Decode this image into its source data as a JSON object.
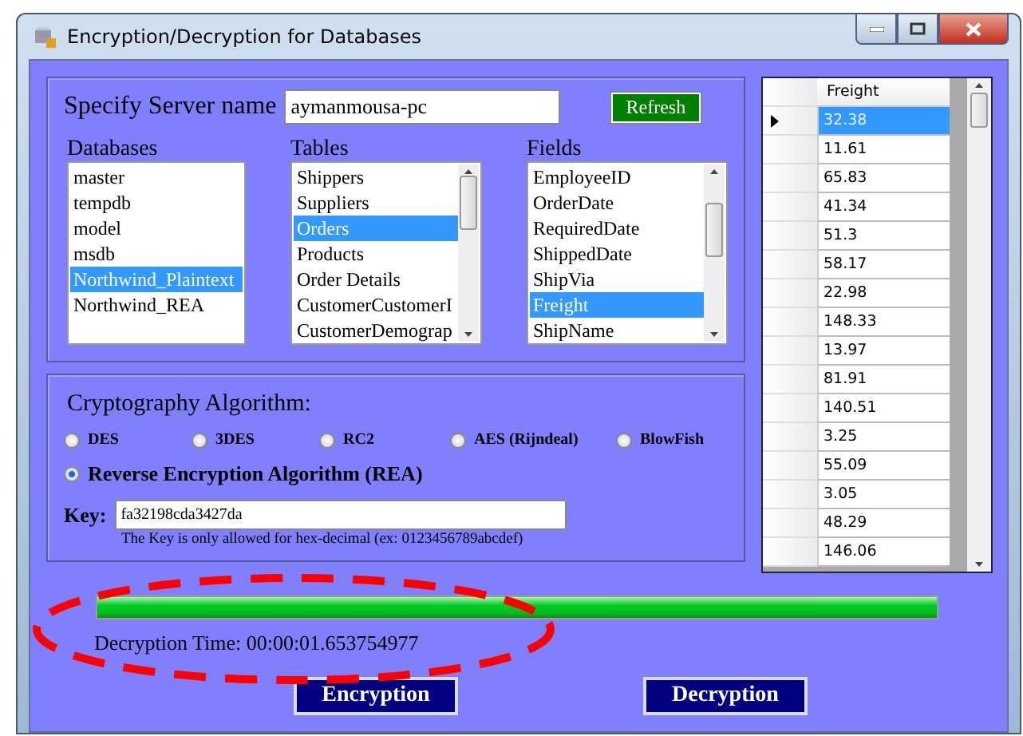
{
  "window": {
    "title": "Encryption/Decryption for Databases"
  },
  "server": {
    "label": "Specify Server name",
    "value": "aymanmousa-pc",
    "refresh": "Refresh"
  },
  "lists": [
    {
      "title": "Databases",
      "scroll": false,
      "items": [
        {
          "label": "master",
          "selected": false
        },
        {
          "label": "tempdb",
          "selected": false
        },
        {
          "label": "model",
          "selected": false
        },
        {
          "label": "msdb",
          "selected": false
        },
        {
          "label": "Northwind_Plaintext",
          "selected": true
        },
        {
          "label": "Northwind_REA",
          "selected": false
        }
      ]
    },
    {
      "title": "Tables",
      "scroll": true,
      "items": [
        {
          "label": "Shippers",
          "selected": false
        },
        {
          "label": "Suppliers",
          "selected": false
        },
        {
          "label": "Orders",
          "selected": true
        },
        {
          "label": "Products",
          "selected": false
        },
        {
          "label": "Order Details",
          "selected": false
        },
        {
          "label": "CustomerCustomerI",
          "selected": false
        },
        {
          "label": "CustomerDemograp",
          "selected": false
        }
      ]
    },
    {
      "title": "Fields",
      "scroll": true,
      "items": [
        {
          "label": "EmployeeID",
          "selected": false
        },
        {
          "label": "OrderDate",
          "selected": false
        },
        {
          "label": "RequiredDate",
          "selected": false
        },
        {
          "label": "ShippedDate",
          "selected": false
        },
        {
          "label": "ShipVia",
          "selected": false
        },
        {
          "label": "Freight",
          "selected": true
        },
        {
          "label": "ShipName",
          "selected": false
        }
      ]
    }
  ],
  "algorithm": {
    "title": "Cryptography Algorithm:",
    "options": [
      {
        "label": "DES",
        "selected": false
      },
      {
        "label": "3DES",
        "selected": false
      },
      {
        "label": "RC2",
        "selected": false
      },
      {
        "label": "AES (Rijndeal)",
        "selected": false
      },
      {
        "label": "BlowFish",
        "selected": false
      },
      {
        "label": "Reverse Encryption Algorithm (REA)",
        "selected": true
      }
    ],
    "key_label": "Key:",
    "key_value": "fa32198cda3427da",
    "key_hint": "The Key is only allowed for hex-decimal  (ex: 0123456789abcdef)"
  },
  "progress": {
    "level": 1.0
  },
  "time": "Decryption Time: 00:00:01.653754977",
  "buttons": [
    "Encryption",
    "Decryption"
  ],
  "grid": {
    "column": "Freight",
    "rows": [
      {
        "value": "32.38",
        "selected": true
      },
      {
        "value": "11.61",
        "selected": false
      },
      {
        "value": "65.83",
        "selected": false
      },
      {
        "value": "41.34",
        "selected": false
      },
      {
        "value": "51.3",
        "selected": false
      },
      {
        "value": "58.17",
        "selected": false
      },
      {
        "value": "22.98",
        "selected": false
      },
      {
        "value": "148.33",
        "selected": false
      },
      {
        "value": "13.97",
        "selected": false
      },
      {
        "value": "81.91",
        "selected": false
      },
      {
        "value": "140.51",
        "selected": false
      },
      {
        "value": "3.25",
        "selected": false
      },
      {
        "value": "55.09",
        "selected": false
      },
      {
        "value": "3.05",
        "selected": false
      },
      {
        "value": "48.29",
        "selected": false
      },
      {
        "value": "146.06",
        "selected": false
      }
    ]
  }
}
